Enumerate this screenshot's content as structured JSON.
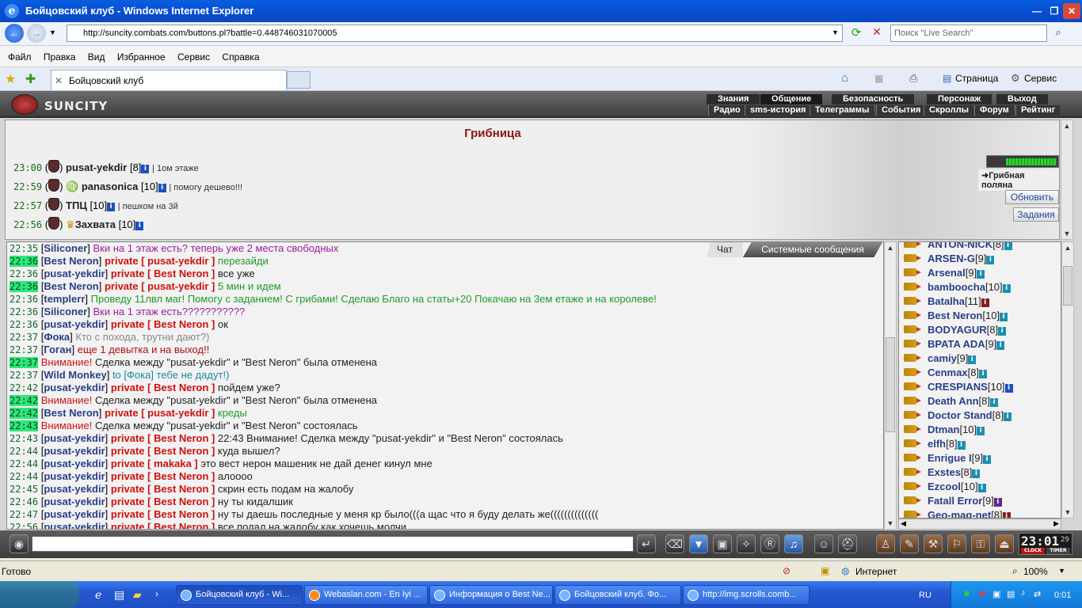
{
  "window": {
    "title": "Бойцовский клуб - Windows Internet Explorer",
    "url": "http://suncity.combats.com/buttons.pl?battle=0.448746031070005",
    "search_placeholder": "Поиск \"Live Search\"",
    "menu": [
      "Файл",
      "Правка",
      "Вид",
      "Избранное",
      "Сервис",
      "Справка"
    ],
    "tab_title": "Бойцовский клуб",
    "cmd_page": "Страница",
    "cmd_service": "Сервис",
    "status": "Готово",
    "zone": "Интернет",
    "zoom": "100%"
  },
  "game": {
    "logo": "SUNCITY",
    "nav_top": [
      "Знания",
      "Общение",
      "Безопасность",
      "Персонаж",
      "Выход"
    ],
    "nav_bottom": [
      "Радио",
      "sms-история",
      "Телеграммы",
      "События",
      "Скроллы",
      "Форум",
      "Рейтинг"
    ],
    "location": "Грибница",
    "location_link": "Грибная поляна",
    "btn_refresh": "Обновить",
    "btn_tasks": "Задания",
    "header_rows": [
      {
        "time": "23:00",
        "name": "pusat-yekdir",
        "level": "[8]",
        "note": "1ом этаже"
      },
      {
        "time": "22:59",
        "name": "panasonica",
        "level": "[10]",
        "note": "помогу дешево!!!"
      },
      {
        "time": "22:57",
        "name": "ТПЦ",
        "level": "[10]",
        "note": "пешком на 3й"
      },
      {
        "time": "22:56",
        "name": "Захвата",
        "level": "[10]",
        "note": ""
      }
    ],
    "chat_tab": "Чат",
    "sys_tab": "Системные сообщения",
    "chat": [
      {
        "t": "22:35",
        "hl": false,
        "nick": "Siliconer",
        "priv": "",
        "warn": "",
        "msg": "Вки на 1 этаж есть? теперь уже 2 места свободных",
        "color": "#9a1fa0"
      },
      {
        "t": "22:36",
        "hl": true,
        "nick": "Best Neron",
        "priv": "private [ pusat-yekdir ]",
        "warn": "",
        "msg": "перезайди",
        "color": "#1f9a2a"
      },
      {
        "t": "22:36",
        "hl": false,
        "nick": "pusat-yekdir",
        "priv": "private [ Best Neron ]",
        "warn": "",
        "msg": "все уже",
        "color": "#222222"
      },
      {
        "t": "22:36",
        "hl": true,
        "nick": "Best Neron",
        "priv": "private [ pusat-yekdir ]",
        "warn": "",
        "msg": "5 мин и идем",
        "color": "#1f9a2a"
      },
      {
        "t": "22:36",
        "hl": false,
        "nick": "templerr",
        "priv": "",
        "warn": "",
        "msg": "Проведу 11лвл маг! Помогу с заданием! С грибами! Сделаю Благо на статы+20 Покачаю на 3ем етаже и на королеве!",
        "color": "#1f9a2a"
      },
      {
        "t": "22:36",
        "hl": false,
        "nick": "Siliconer",
        "priv": "",
        "warn": "",
        "msg": "Вки на 1 этаж есть???????????",
        "color": "#9a1fa0"
      },
      {
        "t": "22:36",
        "hl": false,
        "nick": "pusat-yekdir",
        "priv": "private [ Best Neron ]",
        "warn": "",
        "msg": "ок",
        "color": "#222222"
      },
      {
        "t": "22:37",
        "hl": false,
        "nick": "Фока",
        "priv": "",
        "warn": "",
        "msg": "Кто с похода, трутни дают?)",
        "color": "#888888"
      },
      {
        "t": "22:37",
        "hl": false,
        "nick": "Гоган",
        "priv": "",
        "warn": "",
        "msg": "еще 1 девытка и на выход!!",
        "color": "#b01010"
      },
      {
        "t": "22:37",
        "hl": true,
        "nick": "",
        "priv": "",
        "warn": "Внимание!",
        "msg": "Сделка между \"pusat-yekdir\" и \"Best Neron\" была отменена",
        "color": "#222222"
      },
      {
        "t": "22:37",
        "hl": false,
        "nick": "Wild Monkey",
        "priv": "",
        "warn": "",
        "msg": "to [Фока] тебе не дадут!)",
        "color": "#1a8aa0"
      },
      {
        "t": "22:42",
        "hl": false,
        "nick": "pusat-yekdir",
        "priv": "private [ Best Neron ]",
        "warn": "",
        "msg": "пойдем уже?",
        "color": "#222222"
      },
      {
        "t": "22:42",
        "hl": true,
        "nick": "",
        "priv": "",
        "warn": "Внимание!",
        "msg": "Сделка между \"pusat-yekdir\" и \"Best Neron\" была отменена",
        "color": "#222222"
      },
      {
        "t": "22:42",
        "hl": true,
        "nick": "Best Neron",
        "priv": "private [ pusat-yekdir ]",
        "warn": "",
        "msg": "креды",
        "color": "#1f9a2a"
      },
      {
        "t": "22:43",
        "hl": true,
        "nick": "",
        "priv": "",
        "warn": "Внимание!",
        "msg": "Сделка между \"pusat-yekdir\" и \"Best Neron\" состоялась",
        "color": "#222222"
      },
      {
        "t": "22:43",
        "hl": false,
        "nick": "pusat-yekdir",
        "priv": "private [ Best Neron ]",
        "warn": "",
        "msg": "22:43 Внимание! Сделка между \"pusat-yekdir\" и \"Best Neron\" состоялась",
        "color": "#222222"
      },
      {
        "t": "22:44",
        "hl": false,
        "nick": "pusat-yekdir",
        "priv": "private [ Best Neron ]",
        "warn": "",
        "msg": "куда вышел?",
        "color": "#222222"
      },
      {
        "t": "22:44",
        "hl": false,
        "nick": "pusat-yekdir",
        "priv": "private [ makaka ]",
        "warn": "",
        "msg": "это вест нерон машеник не дай денег кинул мне",
        "color": "#222222"
      },
      {
        "t": "22:44",
        "hl": false,
        "nick": "pusat-yekdir",
        "priv": "private [ Best Neron ]",
        "warn": "",
        "msg": "алоооо",
        "color": "#222222"
      },
      {
        "t": "22:45",
        "hl": false,
        "nick": "pusat-yekdir",
        "priv": "private [ Best Neron ]",
        "warn": "",
        "msg": "скрин есть подам на жалобу",
        "color": "#222222"
      },
      {
        "t": "22:46",
        "hl": false,
        "nick": "pusat-yekdir",
        "priv": "private [ Best Neron ]",
        "warn": "",
        "msg": "ну ты кидалшик",
        "color": "#222222"
      },
      {
        "t": "22:47",
        "hl": false,
        "nick": "pusat-yekdir",
        "priv": "private [ Best Neron ]",
        "warn": "",
        "msg": "ну ты даешь последные у меня кр было(((а щас что я буду делать же((((((((((((((",
        "color": "#222222"
      },
      {
        "t": "22:56",
        "hl": false,
        "nick": "pusat-yekdir",
        "priv": "private [ Best Neron ]",
        "warn": "",
        "msg": "все подал на жалобу как хочешь молчи",
        "color": "#222222"
      }
    ],
    "users": [
      {
        "name": "ANTON-NICK",
        "level": "[8]",
        "info": "cyan"
      },
      {
        "name": "ARSEN-G",
        "level": "[9]",
        "info": "cyan"
      },
      {
        "name": "Arsenal",
        "level": "[9]",
        "info": "cyan"
      },
      {
        "name": "bamboocha",
        "level": "[10]",
        "info": "cyan"
      },
      {
        "name": "Batalha",
        "level": "[11]",
        "info": "red"
      },
      {
        "name": "Best Neron",
        "level": "[10]",
        "info": "cyan"
      },
      {
        "name": "BODYAGUR",
        "level": "[8]",
        "info": "cyan"
      },
      {
        "name": "BPATA ADA",
        "level": "[9]",
        "info": "cyan"
      },
      {
        "name": "camiy",
        "level": "[9]",
        "info": "cyan"
      },
      {
        "name": "Cenmax",
        "level": "[8]",
        "info": "cyan"
      },
      {
        "name": "CRESPIANS",
        "level": "[10]",
        "info": "blue"
      },
      {
        "name": "Death Ann",
        "level": "[8]",
        "info": "cyan"
      },
      {
        "name": "Doctor Stand",
        "level": "[8]",
        "info": "cyan"
      },
      {
        "name": "Dtman",
        "level": "[10]",
        "info": "cyan"
      },
      {
        "name": "elfh",
        "level": "[8]",
        "info": "cyan"
      },
      {
        "name": "Enrigue I",
        "level": "[9]",
        "info": "cyan"
      },
      {
        "name": "Exstes",
        "level": "[8]",
        "info": "cyan"
      },
      {
        "name": "Ezcool",
        "level": "[10]",
        "info": "cyan"
      },
      {
        "name": "Fatall Error",
        "level": "[9]",
        "info": "purple"
      },
      {
        "name": "Geo-mag-net",
        "level": "[8]",
        "info": "red"
      }
    ],
    "clock_time": "23:01",
    "clock_sec": "29",
    "clock_label": "CLOCK",
    "timer_label": "TIMER"
  },
  "taskbar": {
    "tasks": [
      "Бойцовский клуб - Wi...",
      "Webaslan.com - En Iyi ...",
      "Информация о Best Ne...",
      "Бойцовский клуб. Фо...",
      "http://img.scrolls.comb..."
    ],
    "lang": "RU",
    "time": "0:01"
  },
  "colors": {
    "ie_blue": "#0752d6",
    "location_red": "#8b1414",
    "nick_blue": "#2a3e88",
    "private_red": "#d01111",
    "highlight_green": "#2fe67a"
  }
}
